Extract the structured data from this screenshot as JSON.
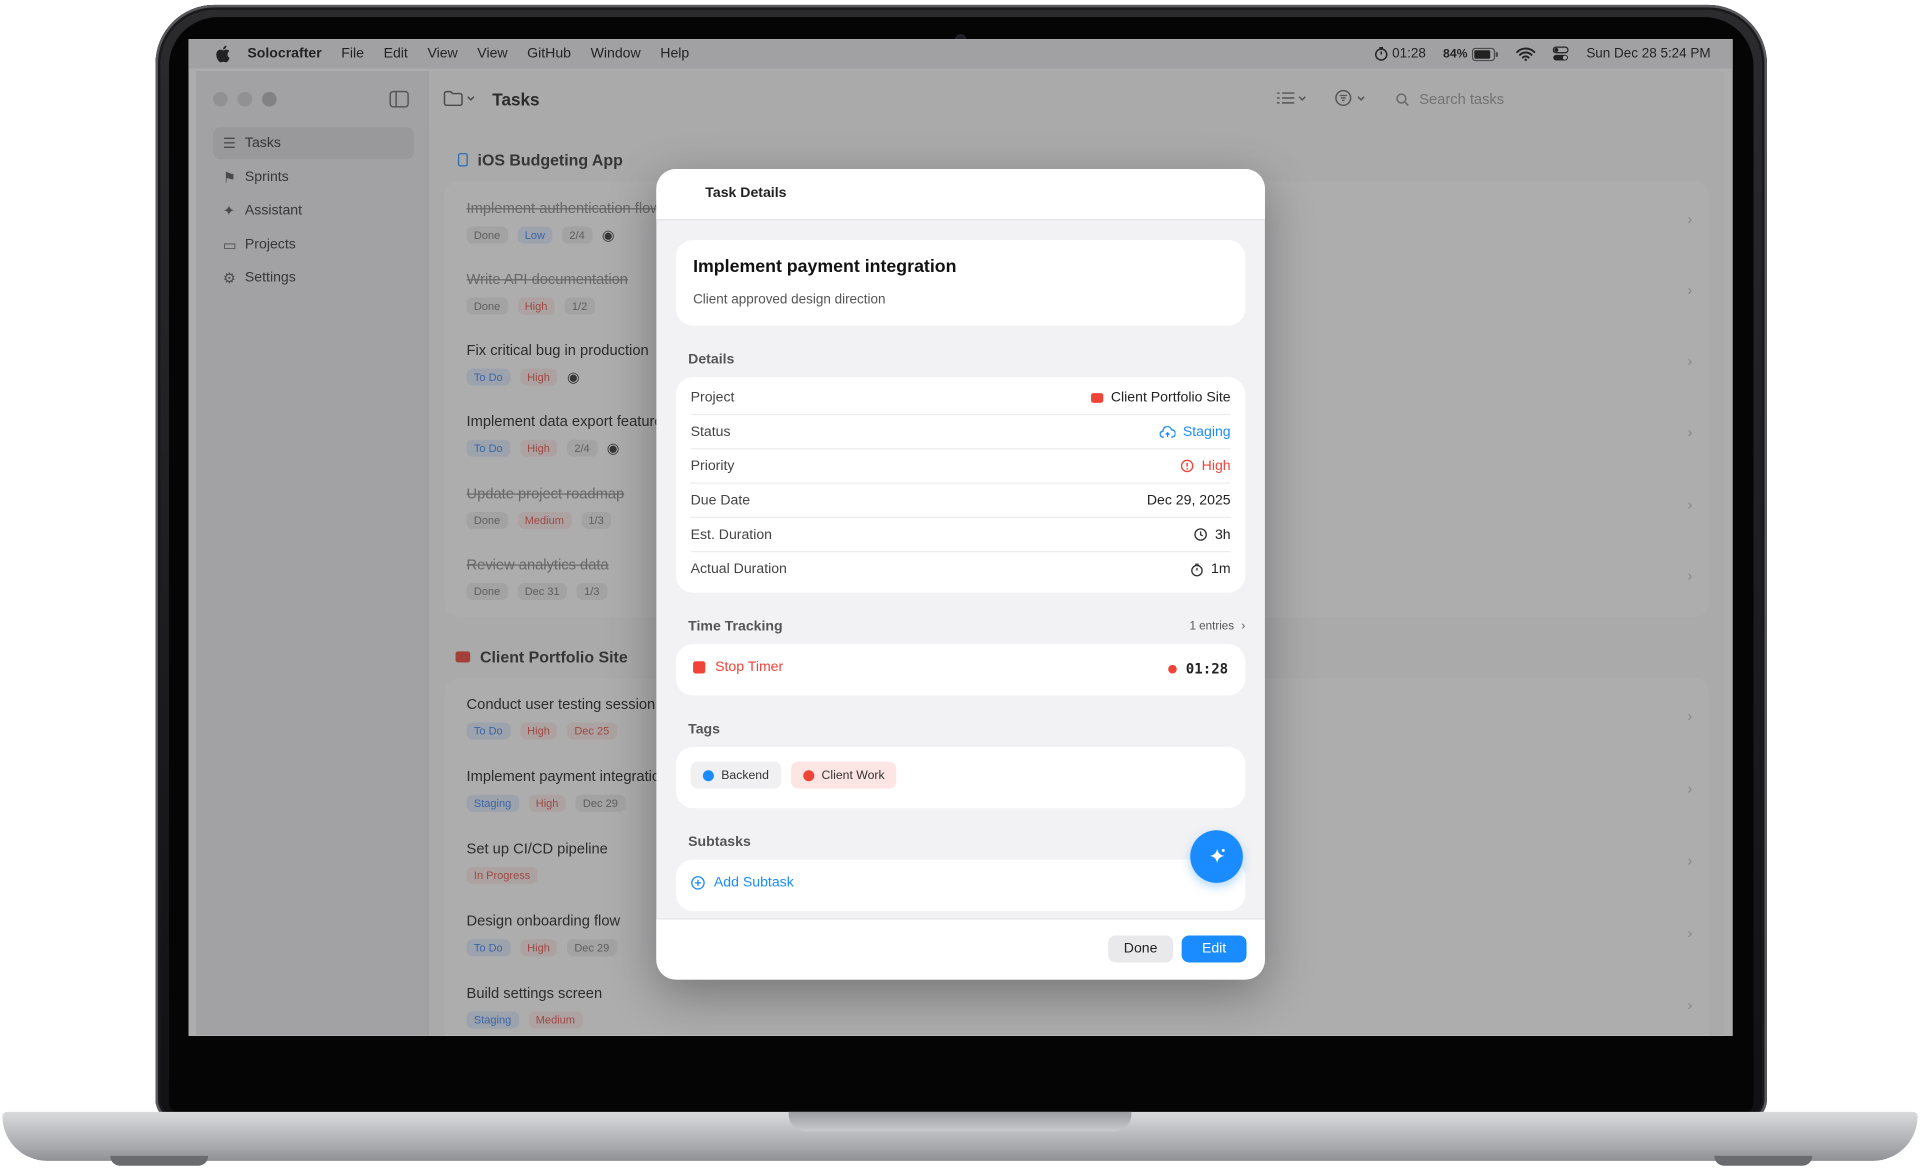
{
  "menubar": {
    "app_name": "Solocrafter",
    "items": [
      "File",
      "Edit",
      "View",
      "View",
      "GitHub",
      "Window",
      "Help"
    ],
    "timer": "01:28",
    "battery": "84%",
    "clock": "Sun Dec 28  5:24 PM"
  },
  "sidebar": {
    "items": [
      {
        "label": "Tasks",
        "icon": "checklist-icon"
      },
      {
        "label": "Sprints",
        "icon": "flag-icon"
      },
      {
        "label": "Assistant",
        "icon": "sparkle-icon"
      },
      {
        "label": "Projects",
        "icon": "folder-icon"
      },
      {
        "label": "Settings",
        "icon": "gear-icon"
      }
    ]
  },
  "toolbar": {
    "title": "Tasks",
    "search_placeholder": "Search tasks"
  },
  "sections": [
    {
      "name": "iOS Budgeting App",
      "tasks": [
        {
          "name": "Implement authentication flow",
          "done": true,
          "chips": [
            {
              "text": "Done",
              "style": "gray"
            },
            {
              "text": "Low",
              "style": "blue"
            },
            {
              "text": "2/4",
              "style": "gray"
            }
          ]
        },
        {
          "name": "Write API documentation",
          "done": true,
          "chips": [
            {
              "text": "Done",
              "style": "gray"
            },
            {
              "text": "High",
              "style": "red"
            },
            {
              "text": "1/2",
              "style": "gray"
            }
          ]
        },
        {
          "name": "Fix critical bug in production",
          "done": false,
          "chips": [
            {
              "text": "To Do",
              "style": "blue"
            },
            {
              "text": "High",
              "style": "red"
            }
          ]
        },
        {
          "name": "Implement data export feature",
          "done": false,
          "chips": [
            {
              "text": "To Do",
              "style": "blue"
            },
            {
              "text": "High",
              "style": "red"
            },
            {
              "text": "2/4",
              "style": "gray"
            }
          ]
        },
        {
          "name": "Update project roadmap",
          "done": true,
          "chips": [
            {
              "text": "Done",
              "style": "gray"
            },
            {
              "text": "Medium",
              "style": "red"
            },
            {
              "text": "1/3",
              "style": "gray"
            }
          ]
        },
        {
          "name": "Review analytics data",
          "done": true,
          "chips": [
            {
              "text": "Done",
              "style": "gray"
            },
            {
              "text": "Dec 31",
              "style": "gray"
            },
            {
              "text": "1/3",
              "style": "gray"
            }
          ]
        }
      ]
    },
    {
      "name": "Client Portfolio Site",
      "tasks": [
        {
          "name": "Conduct user testing session",
          "done": false,
          "chips": [
            {
              "text": "To Do",
              "style": "blue"
            },
            {
              "text": "High",
              "style": "red"
            },
            {
              "text": "Dec 25",
              "style": "red"
            }
          ]
        },
        {
          "name": "Implement payment integratic",
          "done": false,
          "chips": [
            {
              "text": "Staging",
              "style": "blue"
            },
            {
              "text": "High",
              "style": "red"
            },
            {
              "text": "Dec 29",
              "style": "gray"
            }
          ]
        },
        {
          "name": "Set up CI/CD pipeline",
          "done": false,
          "chips": [
            {
              "text": "In Progress",
              "style": "red"
            }
          ]
        },
        {
          "name": "Design onboarding flow",
          "done": false,
          "chips": [
            {
              "text": "To Do",
              "style": "blue"
            },
            {
              "text": "High",
              "style": "red"
            },
            {
              "text": "Dec 29",
              "style": "gray"
            }
          ]
        },
        {
          "name": "Build settings screen",
          "done": false,
          "chips": [
            {
              "text": "Staging",
              "style": "blue"
            },
            {
              "text": "Medium",
              "style": "red"
            }
          ]
        }
      ]
    }
  ],
  "dialog": {
    "header": "Task Details",
    "task_title": "Implement payment integration",
    "task_note": "Client approved design direction",
    "details_label": "Details",
    "details": {
      "project_label": "Project",
      "project_value": "Client Portfolio Site",
      "status_label": "Status",
      "status_value": "Staging",
      "priority_label": "Priority",
      "priority_value": "High",
      "due_label": "Due Date",
      "due_value": "Dec 29, 2025",
      "est_label": "Est. Duration",
      "est_value": "3h",
      "actual_label": "Actual Duration",
      "actual_value": "1m"
    },
    "time_tracking_label": "Time Tracking",
    "entries": "1 entries",
    "stop_timer": "Stop Timer",
    "timer_value": "01:28",
    "tags_label": "Tags",
    "tags": [
      {
        "label": "Backend",
        "color": "#1a8cff"
      },
      {
        "label": "Client Work",
        "color": "#f04438"
      }
    ],
    "subtasks_label": "Subtasks",
    "add_subtask": "Add Subtask",
    "done_button": "Done",
    "edit_button": "Edit"
  },
  "colors": {
    "accent": "#1a8cff",
    "danger": "#f04438"
  }
}
